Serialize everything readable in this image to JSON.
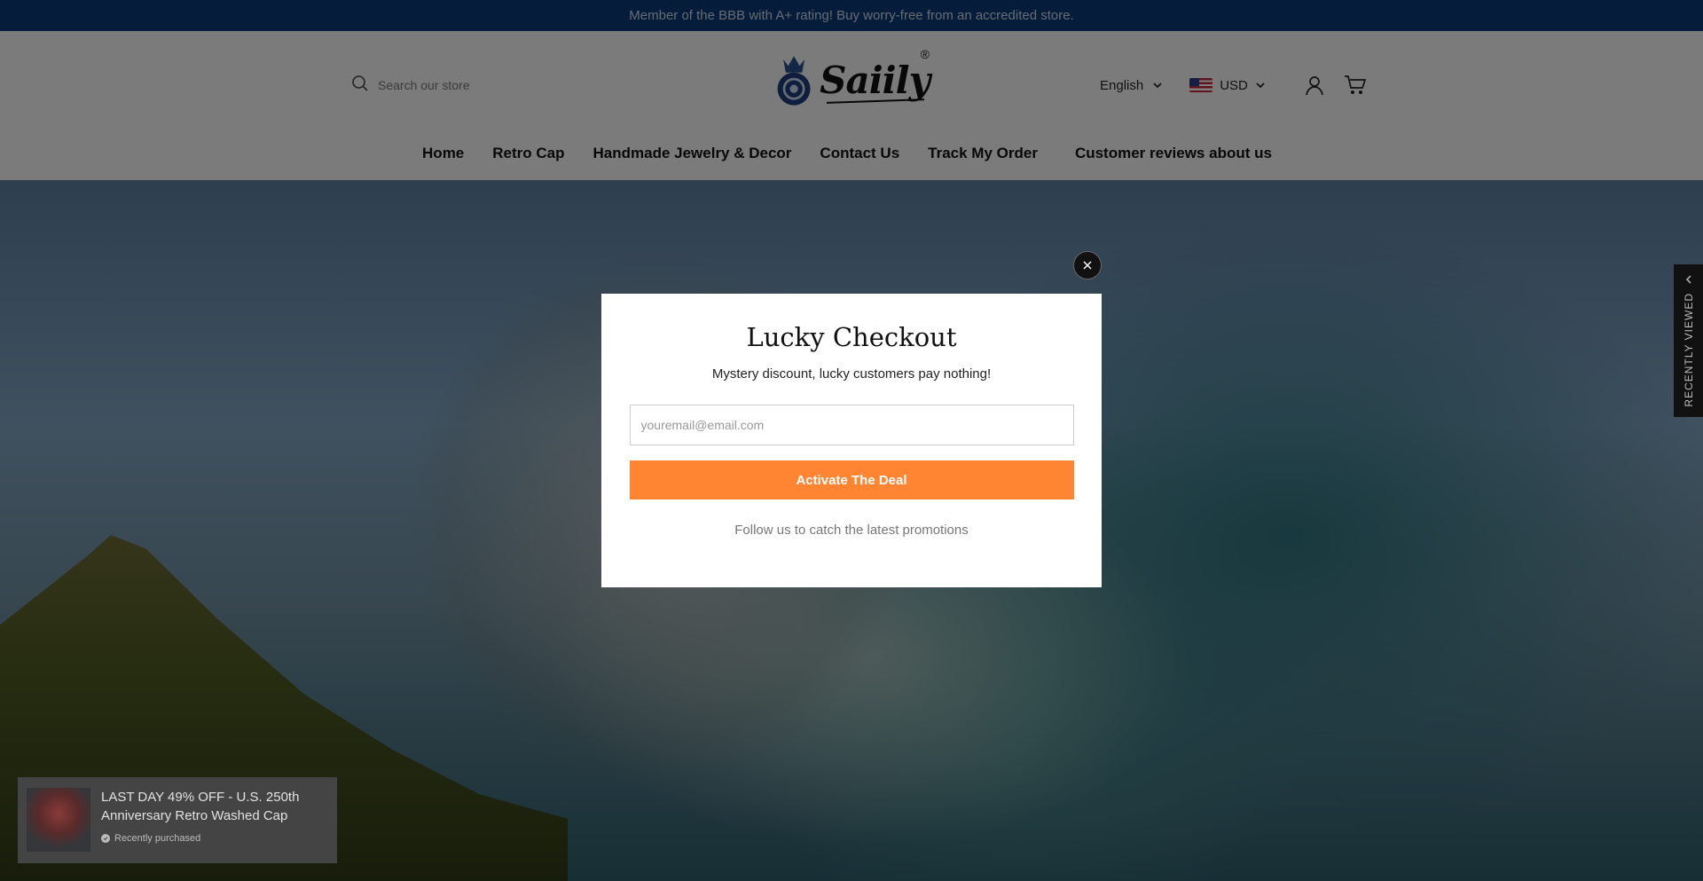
{
  "announcement": {
    "text": "Member of the BBB with A+ rating! Buy worry-free from an accredited store."
  },
  "header": {
    "search_placeholder": "Search our store",
    "logo_text": "Saiily",
    "logo_reg": "®",
    "language": "English",
    "currency": "USD"
  },
  "nav": {
    "items": [
      {
        "label": "Home"
      },
      {
        "label": "Retro Cap"
      },
      {
        "label": "Handmade Jewelry & Decor"
      },
      {
        "label": "Contact Us"
      },
      {
        "label": "Track My Order"
      },
      {
        "label": "Customer reviews about us"
      }
    ]
  },
  "recently_viewed": {
    "label": "RECENTLY VIEWED"
  },
  "modal": {
    "title": "Lucky Checkout",
    "subtitle": "Mystery discount, lucky customers pay nothing!",
    "email_placeholder": "youremail@email.com",
    "button_label": "Activate The Deal",
    "follow_text": "Follow us to catch the latest promotions",
    "button_color": "#ff8533"
  },
  "toast": {
    "title": "LAST DAY 49% OFF - U.S. 250th Anniversary Retro Washed Cap",
    "meta": "Recently purchased"
  },
  "colors": {
    "announcement_bg": "#0b3a74",
    "accent": "#ff8533"
  }
}
